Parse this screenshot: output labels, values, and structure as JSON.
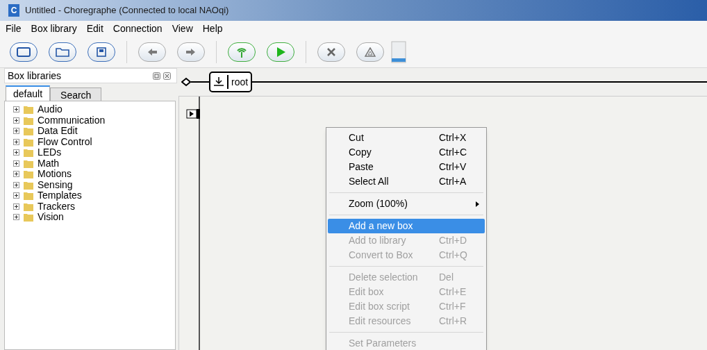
{
  "window": {
    "title": "Untitled - Choregraphe (Connected to local NAOqi)",
    "app_letter": "C"
  },
  "menu_bar": [
    "File",
    "Box library",
    "Edit",
    "Connection",
    "View",
    "Help"
  ],
  "box_libraries": {
    "title": "Box libraries",
    "tabs": [
      {
        "label": "default",
        "selected": true
      },
      {
        "label": "Search",
        "selected": false
      }
    ],
    "items": [
      {
        "label": "Audio",
        "expanded": false
      },
      {
        "label": "Communication",
        "expanded": false
      },
      {
        "label": "Data Edit",
        "expanded": false
      },
      {
        "label": "Flow Control",
        "expanded": false
      },
      {
        "label": "LEDs",
        "expanded": false
      },
      {
        "label": "Math",
        "expanded": false
      },
      {
        "label": "Motions",
        "expanded": false
      },
      {
        "label": "Sensing",
        "expanded": false
      },
      {
        "label": "Templates",
        "expanded": false
      },
      {
        "label": "Trackers",
        "expanded": false
      },
      {
        "label": "Vision",
        "expanded": false
      }
    ]
  },
  "breadcrumb": {
    "label": "root"
  },
  "context_menu": [
    {
      "kind": "item",
      "label": "Cut",
      "shortcut": "Ctrl+X",
      "disabled": false,
      "selected": false
    },
    {
      "kind": "item",
      "label": "Copy",
      "shortcut": "Ctrl+C",
      "disabled": false,
      "selected": false
    },
    {
      "kind": "item",
      "label": "Paste",
      "shortcut": "Ctrl+V",
      "disabled": false,
      "selected": false
    },
    {
      "kind": "item",
      "label": "Select All",
      "shortcut": "Ctrl+A",
      "disabled": false,
      "selected": false
    },
    {
      "kind": "separator"
    },
    {
      "kind": "submenu",
      "label": "Zoom (100%)",
      "disabled": false,
      "selected": false
    },
    {
      "kind": "separator"
    },
    {
      "kind": "item",
      "label": "Add a new box",
      "disabled": false,
      "selected": true
    },
    {
      "kind": "item",
      "label": "Add to library",
      "shortcut": "Ctrl+D",
      "disabled": true,
      "selected": false
    },
    {
      "kind": "item",
      "label": "Convert to Box",
      "shortcut": "Ctrl+Q",
      "disabled": true,
      "selected": false
    },
    {
      "kind": "separator"
    },
    {
      "kind": "item",
      "label": "Delete selection",
      "shortcut": "Del",
      "disabled": true,
      "selected": false
    },
    {
      "kind": "item",
      "label": "Edit box",
      "shortcut": "Ctrl+E",
      "disabled": true,
      "selected": false
    },
    {
      "kind": "item",
      "label": "Edit box script",
      "shortcut": "Ctrl+F",
      "disabled": true,
      "selected": false
    },
    {
      "kind": "item",
      "label": "Edit resources",
      "shortcut": "Ctrl+R",
      "disabled": true,
      "selected": false
    },
    {
      "kind": "separator"
    },
    {
      "kind": "item",
      "label": "Set Parameters",
      "disabled": true,
      "selected": false
    }
  ]
}
